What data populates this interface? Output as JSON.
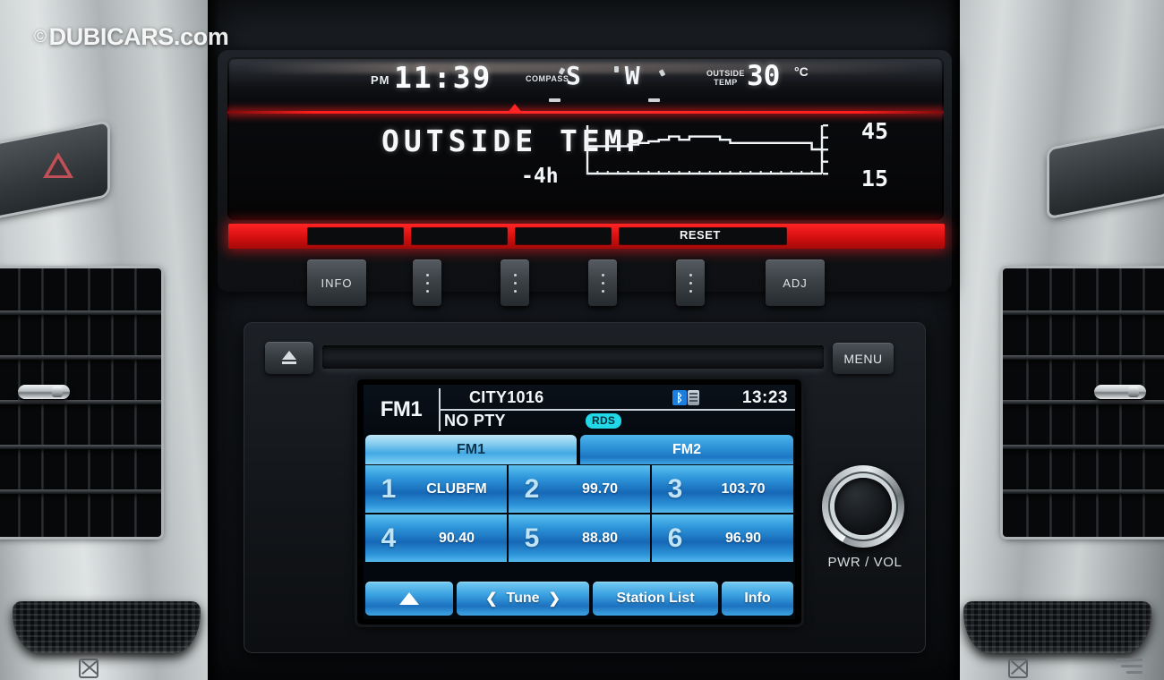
{
  "watermark": {
    "copyright": "©",
    "text": "DUBICARS.com"
  },
  "info_display": {
    "time_meridiem": "PM",
    "time": "11:39",
    "compass_label": "COMPASS",
    "compass_heading": "S W",
    "outside_temp_label_line1": "OUTSIDE",
    "outside_temp_label_line2": "TEMP",
    "outside_temp_value": "30",
    "outside_temp_unit": "°C",
    "screen_title": "OUTSIDE TEMP",
    "graph_time_label": "-4h",
    "graph_scale_high": "45",
    "graph_scale_low": "15",
    "reset_label": "RESET",
    "buttons": [
      {
        "label": "INFO",
        "type": "text"
      },
      {
        "label": "",
        "type": "dots"
      },
      {
        "label": "",
        "type": "dots"
      },
      {
        "label": "",
        "type": "dots"
      },
      {
        "label": "",
        "type": "dots"
      },
      {
        "label": "ADJ",
        "type": "text"
      }
    ]
  },
  "chart_data": {
    "type": "line",
    "title": "OUTSIDE TEMP",
    "xlabel": "-4h",
    "ylabel": "°C",
    "ylim": [
      15,
      45
    ],
    "yticks": [
      "45",
      "15"
    ],
    "grid": false,
    "legend": "none",
    "x": [
      0,
      1,
      2,
      3,
      4,
      5,
      6,
      7,
      8,
      9,
      10,
      11,
      12,
      13,
      14,
      15,
      16,
      17,
      18,
      19,
      20,
      21,
      22,
      23
    ],
    "values": [
      32,
      32,
      32,
      32,
      33,
      34,
      35,
      36,
      38,
      36,
      38,
      38,
      38,
      36,
      34,
      34,
      34,
      34,
      34,
      34,
      34,
      34,
      30,
      28
    ]
  },
  "head_unit": {
    "eject_icon": "eject-icon",
    "menu_label": "MENU",
    "knob_label": "PWR / VOL",
    "screen": {
      "band": "FM1",
      "station_name": "CITY1016",
      "program_type": "NO PTY",
      "clock": "13:23",
      "rds_badge": "RDS",
      "bluetooth_icon": "bluetooth-icon",
      "tabs": [
        {
          "label": "FM1",
          "active": true
        },
        {
          "label": "FM2",
          "active": false
        }
      ],
      "presets": [
        {
          "number": "1",
          "value": "CLUBFM"
        },
        {
          "number": "2",
          "value": "99.70"
        },
        {
          "number": "3",
          "value": "103.70"
        },
        {
          "number": "4",
          "value": "90.40"
        },
        {
          "number": "5",
          "value": "88.80"
        },
        {
          "number": "6",
          "value": "96.90"
        }
      ],
      "soft_buttons": [
        {
          "label": "",
          "icon": "arrow-up-icon"
        },
        {
          "label": "Tune",
          "icon": "tune-arrows"
        },
        {
          "label": "Station List",
          "icon": ""
        },
        {
          "label": "Info",
          "icon": ""
        }
      ]
    }
  },
  "colors": {
    "red_bar": "#ff2424",
    "screen_blue": "#2f97db",
    "rds_cyan": "#21d7e8",
    "bluetooth_blue": "#1b7fe0"
  }
}
